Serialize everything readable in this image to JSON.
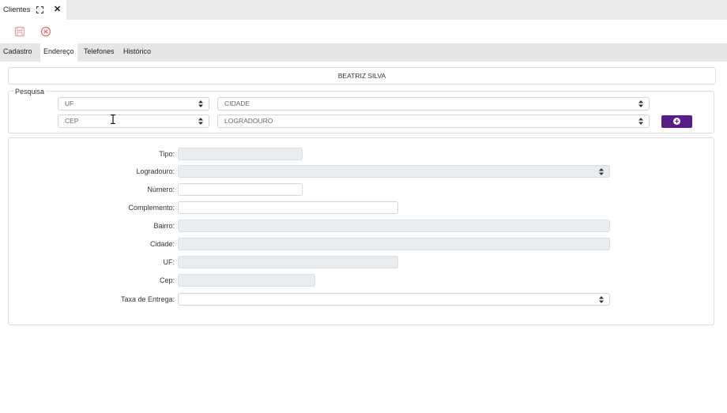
{
  "window": {
    "tab_title": "Clientes",
    "maximize_icon": "maximize-icon",
    "close_icon": "close-icon"
  },
  "toolbar": {
    "save_icon": "save-icon",
    "cancel_icon": "cancel-icon",
    "save_color": "#e9a3a6",
    "cancel_color": "#e06b74"
  },
  "tabs": [
    {
      "label": "Cadastro"
    },
    {
      "label": "Endereço"
    },
    {
      "label": "Telefones"
    },
    {
      "label": "Histórico"
    }
  ],
  "client_name": "BEATRIZ SILVA",
  "search": {
    "legend": "Pesquisa",
    "uf_placeholder": "UF",
    "cidade_placeholder": "CIDADE",
    "cep_placeholder": "CEP",
    "logradouro_placeholder": "LOGRADOURO",
    "add_button_icon": "plus-circle-icon",
    "accent_color": "#5b1a8a"
  },
  "form": {
    "tipo": {
      "label": "Tipo:",
      "value": ""
    },
    "logradouro": {
      "label": "Logradouro:",
      "value": ""
    },
    "numero": {
      "label": "Número:",
      "value": ""
    },
    "complemento": {
      "label": "Complemento:",
      "value": ""
    },
    "bairro": {
      "label": "Bairro:",
      "value": ""
    },
    "cidade": {
      "label": "Cidade:",
      "value": ""
    },
    "uf": {
      "label": "UF:",
      "value": ""
    },
    "cep": {
      "label": "Cep:",
      "value": ""
    },
    "taxa": {
      "label": "Taxa de Entrega:",
      "value": ""
    }
  }
}
